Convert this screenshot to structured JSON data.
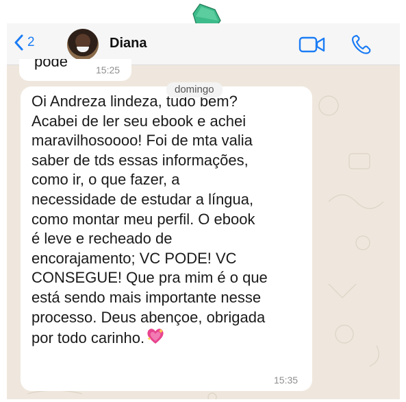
{
  "header": {
    "back_count": "2",
    "contact_name": "Diana"
  },
  "previous_message": {
    "text": "pode",
    "time": "15:25"
  },
  "date_separator": "domingo",
  "message": {
    "text": "Oi Andreza lindeza, tudo bem?\nAcabei de ler seu ebook e achei\nmaravilhosoooo! Foi de mta valia\nsaber de tds essas informações,\ncomo ir, o que fazer,  a\nnecessidade de estudar a língua,\ncomo montar meu perfil. O ebook\né leve e recheado de\nencorajamento; VC PODE! VC\nCONSEGUE! Que pra mim é o que\nestá sendo mais importante nesse\nprocesso. Deus abençoe, obrigada\npor todo carinho.",
    "emoji": "sparkling-heart-icon",
    "time": "15:35"
  },
  "colors": {
    "accent": "#1b7cf5",
    "chat_background": "#efe7dd",
    "bubble": "#ffffff",
    "pin": "#3dbb8a"
  }
}
